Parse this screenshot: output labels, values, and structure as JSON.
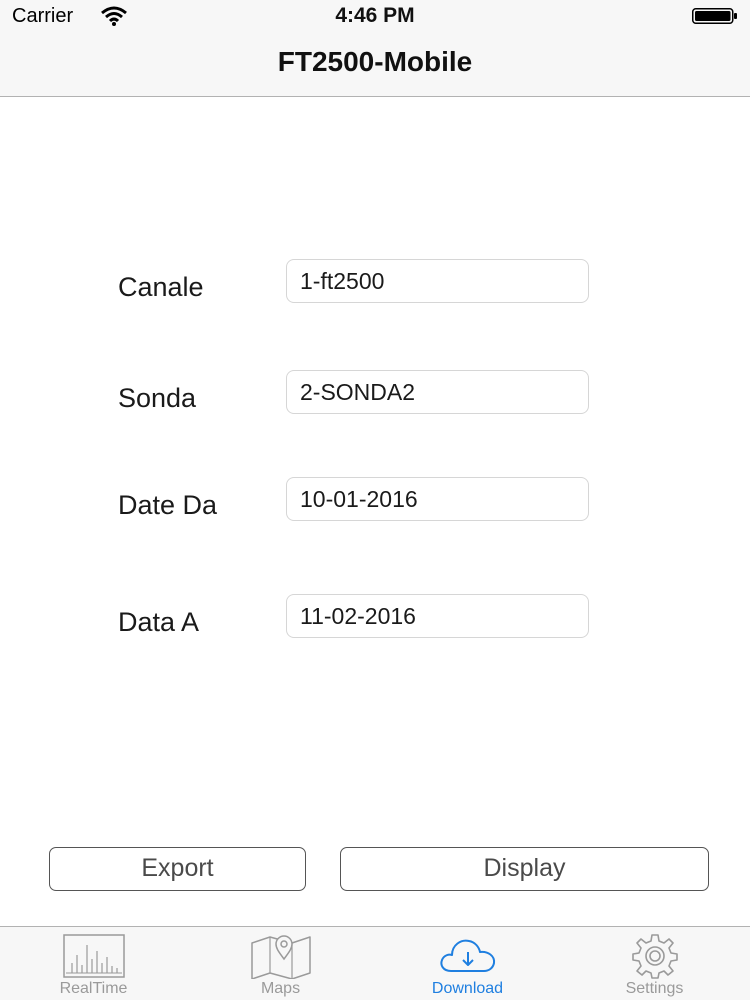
{
  "status_bar": {
    "carrier": "Carrier",
    "time": "4:46 PM"
  },
  "nav": {
    "title": "FT2500-Mobile"
  },
  "form": {
    "canale_label": "Canale",
    "canale_value": "1-ft2500",
    "sonda_label": "Sonda",
    "sonda_value": "2-SONDA2",
    "date_da_label": "Date Da",
    "date_da_value": "10-01-2016",
    "data_a_label": "Data A",
    "data_a_value": "11-02-2016"
  },
  "buttons": {
    "export_label": "Export",
    "display_label": "Display"
  },
  "tabs": [
    {
      "label": "RealTime",
      "icon": "realtime-chart-icon"
    },
    {
      "label": "Maps",
      "icon": "map-icon"
    },
    {
      "label": "Download",
      "icon": "cloud-download-icon",
      "active": true
    },
    {
      "label": "Settings",
      "icon": "gear-icon"
    }
  ],
  "colors": {
    "accent": "#1f7fe0",
    "inactive_tab": "#9a9a9a",
    "bar_background": "#f7f7f7"
  }
}
